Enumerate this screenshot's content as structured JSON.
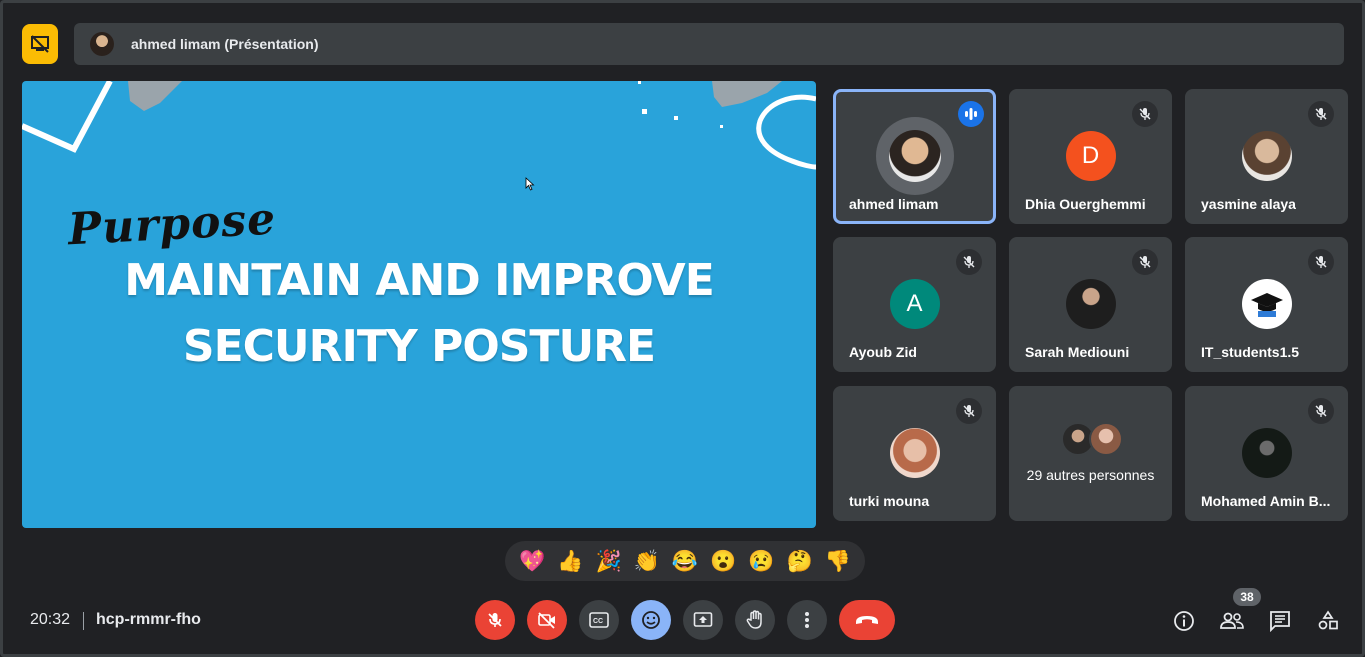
{
  "header": {
    "presenter_title": "ahmed limam (Présentation)"
  },
  "slide": {
    "script_word": "Purpose",
    "headline_line1": "MAINTAIN AND IMPROVE",
    "headline_line2": "SECURITY POSTURE",
    "background_color": "#29a3da"
  },
  "participants": [
    {
      "name": "ahmed limam",
      "avatar": "photo",
      "speaking": true
    },
    {
      "name": "Dhia Ouerghemmi",
      "avatar_letter": "D",
      "avatar_color": "#f4511e",
      "muted": true
    },
    {
      "name": "yasmine alaya",
      "avatar": "photo",
      "muted": true
    },
    {
      "name": "Ayoub Zid",
      "avatar_letter": "A",
      "avatar_color": "#00897b",
      "muted": true
    },
    {
      "name": "Sarah Mediouni",
      "avatar": "photo",
      "muted": true
    },
    {
      "name": "IT_students1.5",
      "avatar": "logo",
      "muted": true
    },
    {
      "name": "turki mouna",
      "avatar": "photo",
      "muted": true
    },
    {
      "others_label": "29 autres personnes"
    },
    {
      "name": "Mohamed Amin B...",
      "avatar": "photo",
      "muted": true
    }
  ],
  "reactions": [
    "💖",
    "👍",
    "🎉",
    "👏",
    "😂",
    "😮",
    "😢",
    "🤔",
    "👎"
  ],
  "footer": {
    "time": "20:32",
    "meeting_code": "hcp-rmmr-fho",
    "participant_count": "38"
  },
  "colors": {
    "accent_yellow": "#fbbc04",
    "danger_red": "#ea4335",
    "active_blue": "#8ab4f8",
    "speaking_blue": "#1a73e8"
  }
}
